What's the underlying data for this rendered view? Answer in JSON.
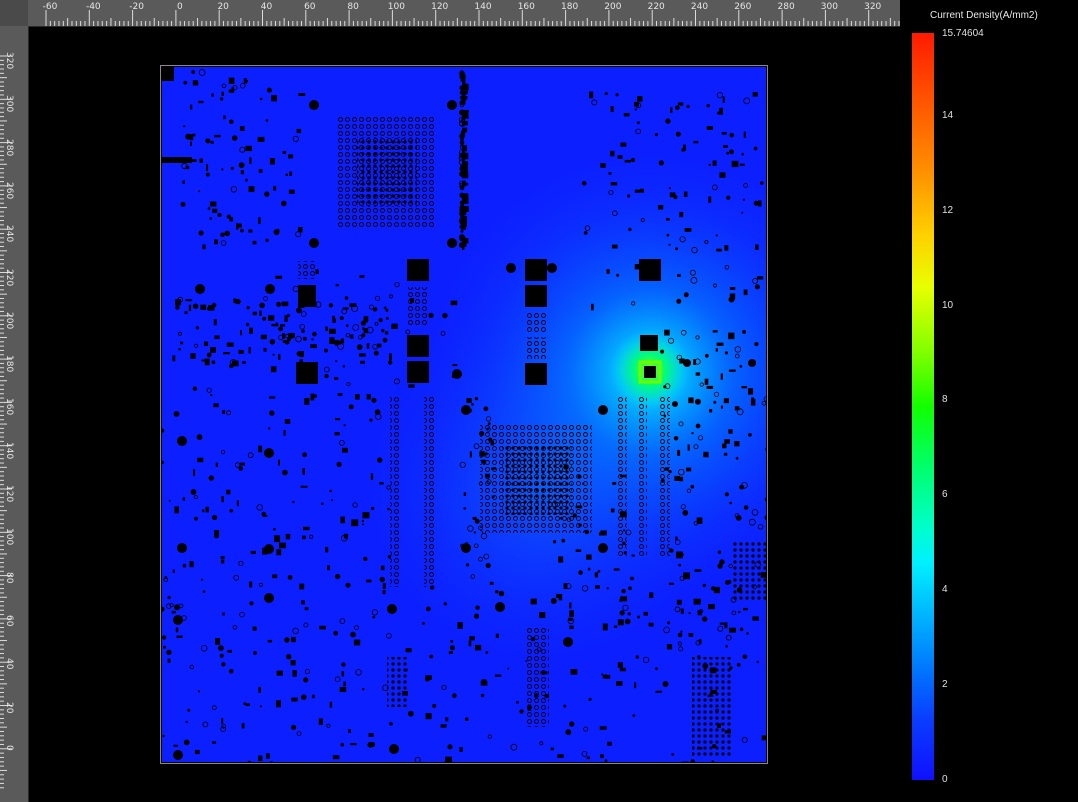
{
  "legend": {
    "title": "Current Density(A/mm2)",
    "max_label": "15.74604",
    "ticks": [
      "14",
      "12",
      "10",
      "8",
      "6",
      "4",
      "2",
      "0"
    ],
    "max_value": 15.74604
  },
  "ruler_top": {
    "labels": [
      "-60",
      "-40",
      "-20",
      "0",
      "20",
      "40",
      "60",
      "80",
      "100",
      "120",
      "140",
      "160",
      "180",
      "200",
      "220",
      "240",
      "260",
      "280",
      "300",
      "320"
    ]
  },
  "ruler_left": {
    "labels": [
      "320",
      "300",
      "280",
      "260",
      "240",
      "220",
      "200",
      "180",
      "160",
      "140",
      "120",
      "100",
      "80",
      "60",
      "40",
      "20",
      "0"
    ]
  },
  "colors": {
    "background": "#000000",
    "ruler": "#5a5a5a",
    "board_base": "#0c1fff",
    "hotspot": "#00ff60"
  }
}
